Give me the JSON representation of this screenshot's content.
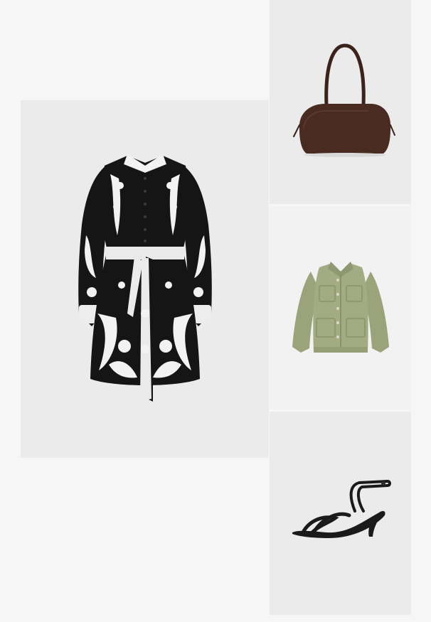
{
  "outfit": {
    "items": [
      {
        "key": "dress",
        "label": "Black and white floral print belted shirt dress"
      },
      {
        "key": "bag",
        "label": "Brown suede shoulder bag"
      },
      {
        "key": "jacket",
        "label": "Khaki green utility overshirt jacket"
      },
      {
        "key": "sandal",
        "label": "Black strappy kitten-heel sandal"
      }
    ]
  },
  "colors": {
    "page_background": "#f6f6f6",
    "tile_background": "#ebebeb",
    "dress_black": "#151515",
    "dress_print": "#f2f2f2",
    "bag_brown": "#4a2b22",
    "jacket_khaki": "#a2ab82",
    "sandal_black": "#1a1a1a"
  }
}
